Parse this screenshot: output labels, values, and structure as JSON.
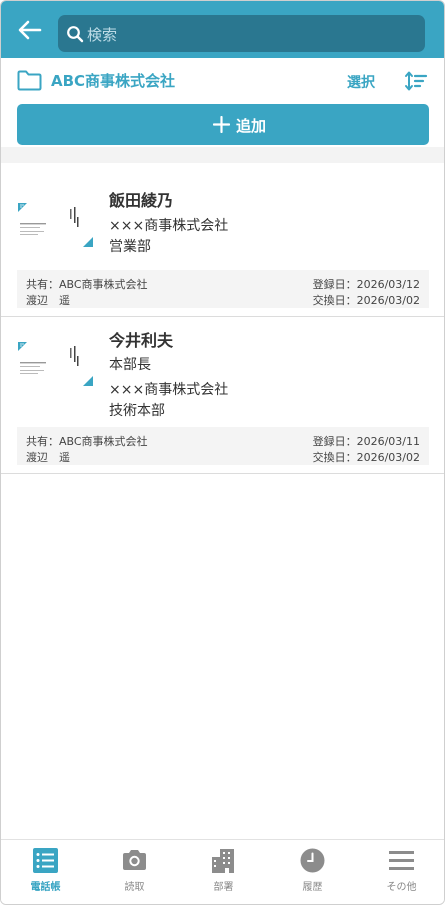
{
  "header": {
    "search_placeholder": "検索"
  },
  "folder": {
    "name": "ABC商事株式会社",
    "select_label": "選択"
  },
  "add_button": {
    "label": "追加"
  },
  "cards": [
    {
      "name": "飯田綾乃",
      "lines": [
        "×××商事株式会社",
        "営業部"
      ],
      "shared": "共有：ABC商事株式会社",
      "owner": "渡辺　遥",
      "registered": "登録日：2026/03/12",
      "exchanged": "交換日：2026/03/02"
    },
    {
      "name": "今井利夫",
      "lines": [
        "本部長",
        "×××商事株式会社",
        "技術本部"
      ],
      "shared": "共有：ABC商事株式会社",
      "owner": "渡辺　遥",
      "registered": "登録日：2026/03/11",
      "exchanged": "交換日：2026/03/02"
    }
  ],
  "nav": [
    {
      "label": "電話帳",
      "icon": "phonebook-icon",
      "active": true
    },
    {
      "label": "読取",
      "icon": "camera-icon"
    },
    {
      "label": "部署",
      "icon": "building-icon"
    },
    {
      "label": "履歴",
      "icon": "clock-icon"
    },
    {
      "label": "その他",
      "icon": "menu-icon"
    }
  ],
  "colors": {
    "accent": "#3aa5c3",
    "search_bg": "#2a7790",
    "meta_bg": "#f4f4f4"
  }
}
